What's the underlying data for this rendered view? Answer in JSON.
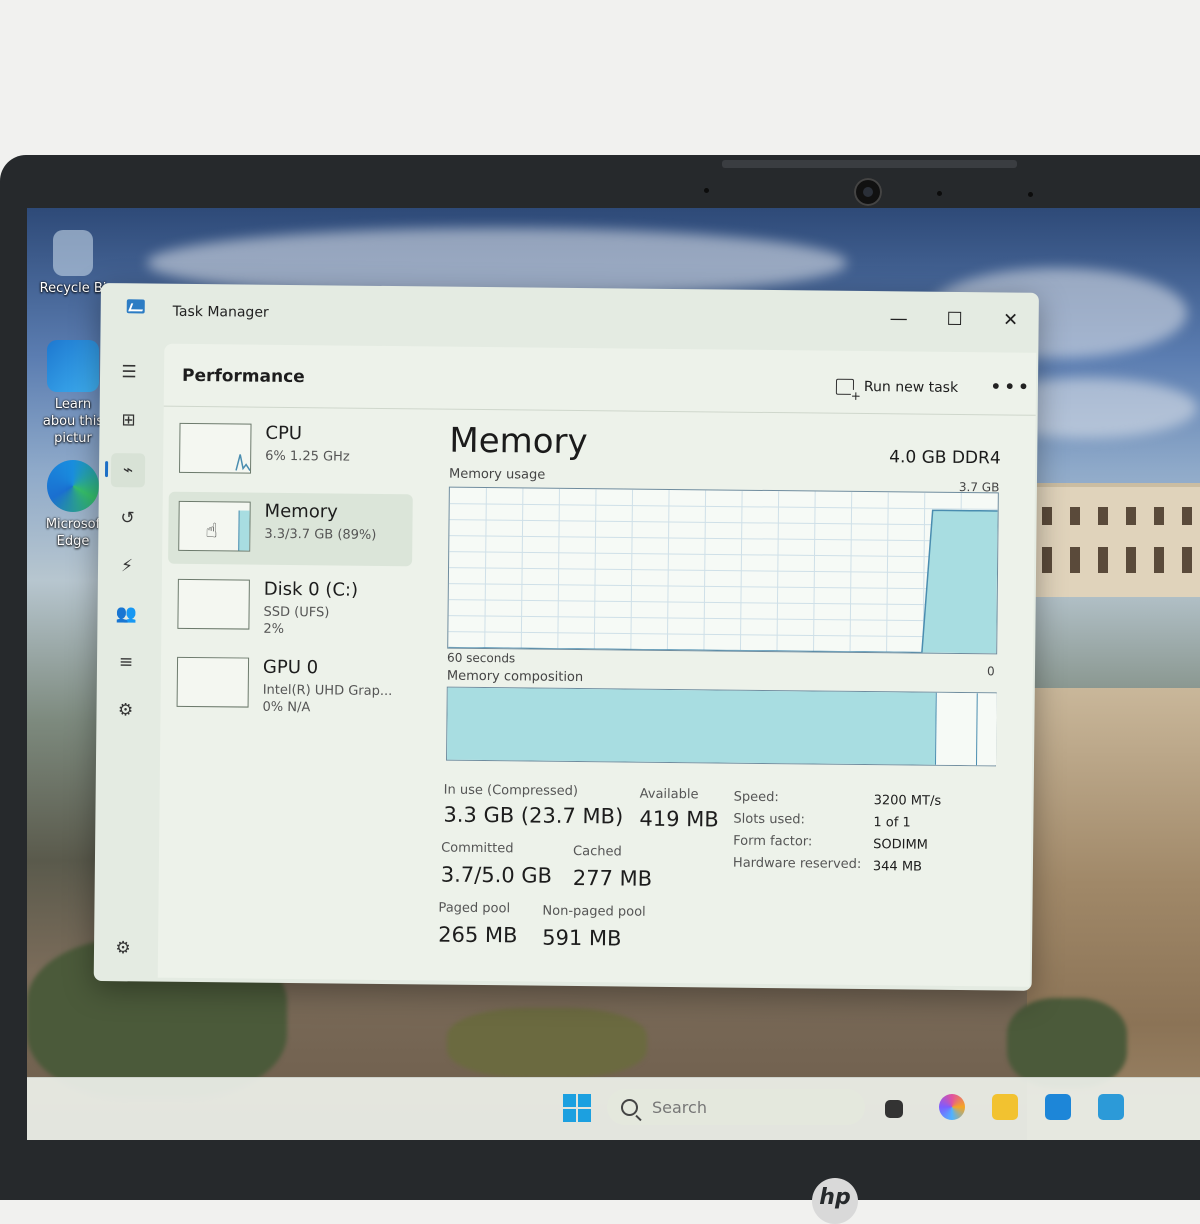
{
  "window": {
    "title": "Task Manager",
    "minimize_icon": "minimize-icon",
    "maximize_icon": "maximize-icon",
    "close_icon": "close-icon"
  },
  "header": {
    "title": "Performance",
    "run_new_task": "Run new task",
    "more_icon": "more-options-icon"
  },
  "nav_rail": [
    "hamburger-menu-icon",
    "processes-icon",
    "performance-icon",
    "app-history-icon",
    "startup-apps-icon",
    "users-icon",
    "details-icon",
    "services-icon",
    "settings-icon"
  ],
  "resources": [
    {
      "name": "CPU",
      "sub": "6%  1.25 GHz",
      "sub2": ""
    },
    {
      "name": "Memory",
      "sub": "3.3/3.7 GB (89%)",
      "sub2": ""
    },
    {
      "name": "Disk 0 (C:)",
      "sub": "SSD (UFS)",
      "sub2": "2%"
    },
    {
      "name": "GPU 0",
      "sub": "Intel(R) UHD Grap...",
      "sub2": "0%  N/A"
    }
  ],
  "memory": {
    "title": "Memory",
    "spec": "4.0 GB DDR4",
    "usage_label": "Memory usage",
    "max_label": "3.7 GB",
    "time_label": "60 seconds",
    "zero_label": "0",
    "composition_label": "Memory composition",
    "usage_fraction_history": [
      0,
      0,
      0,
      0,
      0,
      0,
      0,
      0,
      0,
      0,
      0,
      0,
      0,
      0,
      0,
      0,
      0,
      0,
      0,
      0,
      0,
      0,
      0,
      0,
      0,
      0,
      0,
      0,
      0,
      0,
      0,
      0,
      0,
      0,
      0,
      0,
      0,
      0,
      0,
      0,
      0,
      0,
      0,
      0,
      0,
      0,
      0,
      0,
      0,
      0,
      0,
      0,
      0.89,
      0.89,
      0.89,
      0.89,
      0.89,
      0.89,
      0.89,
      0.89
    ],
    "composition_fractions": {
      "in_use": 0.89,
      "modified": 0.0,
      "standby": 0.075,
      "free": 0.035
    },
    "stats": [
      {
        "label": "In use (Compressed)",
        "value": "3.3 GB (23.7 MB)"
      },
      {
        "label": "Available",
        "value": "419 MB"
      },
      {
        "label": "Committed",
        "value": "3.7/5.0 GB"
      },
      {
        "label": "Cached",
        "value": "277 MB"
      },
      {
        "label": "Paged pool",
        "value": "265 MB"
      },
      {
        "label": "Non-paged pool",
        "value": "591 MB"
      }
    ],
    "specs": [
      {
        "label": "Speed:",
        "value": "3200 MT/s"
      },
      {
        "label": "Slots used:",
        "value": "1 of 1"
      },
      {
        "label": "Form factor:",
        "value": "SODIMM"
      },
      {
        "label": "Hardware reserved:",
        "value": "344 MB"
      }
    ]
  },
  "desktop": {
    "icons": [
      {
        "label": "Recycle Bi",
        "icon": "recycle-bin-icon"
      },
      {
        "label": "Learn abou this pictur",
        "icon": "learn-about-picture-icon"
      },
      {
        "label": "Microsof Edge",
        "icon": "edge-icon"
      }
    ]
  },
  "taskbar": {
    "search_placeholder": "Search",
    "apps": [
      "task-view-icon",
      "copilot-icon",
      "file-explorer-icon",
      "store-icon",
      "task-manager-icon"
    ]
  },
  "colors": {
    "accent": "#1d6fc6",
    "memory_fill": "#a8dde1",
    "memory_line": "#4a8db0"
  },
  "brand": "hp"
}
